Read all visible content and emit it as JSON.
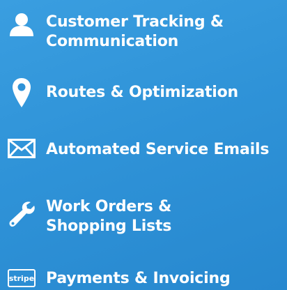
{
  "features": [
    {
      "icon": "user-icon",
      "label": "Customer Tracking &\nCommunication"
    },
    {
      "icon": "map-pin-icon",
      "label": "Routes & Optimization"
    },
    {
      "icon": "envelope-icon",
      "label": "Automated Service Emails"
    },
    {
      "icon": "wrench-icon",
      "label": "Work Orders &\nShopping Lists"
    },
    {
      "icon": "stripe-icon",
      "label": "Payments & Invoicing",
      "badge_text": "stripe"
    }
  ],
  "colors": {
    "background": "#2f93d8",
    "text": "#ffffff"
  }
}
